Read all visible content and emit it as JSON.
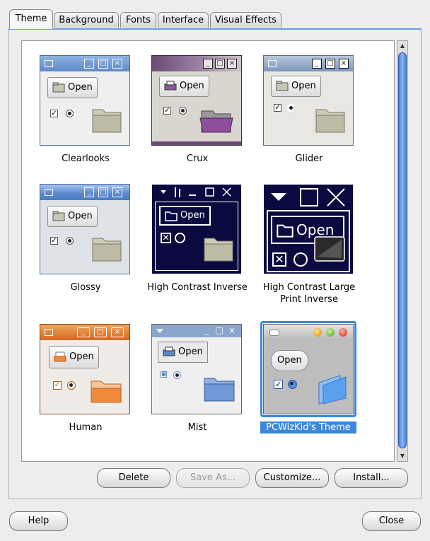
{
  "tabs": [
    {
      "label": "Theme",
      "active": true
    },
    {
      "label": "Background"
    },
    {
      "label": "Fonts"
    },
    {
      "label": "Interface"
    },
    {
      "label": "Visual Effects"
    }
  ],
  "themes": [
    {
      "name": "Clearlooks",
      "open": "Open"
    },
    {
      "name": "Crux",
      "open": "Open"
    },
    {
      "name": "Glider",
      "open": "Open"
    },
    {
      "name": "Glossy",
      "open": "Open"
    },
    {
      "name": "High Contrast Inverse",
      "open": "Open"
    },
    {
      "name": "High Contrast Large Print Inverse",
      "open": "Open"
    },
    {
      "name": "Human",
      "open": "Open"
    },
    {
      "name": "Mist",
      "open": "Open"
    },
    {
      "name": "PCWizKid's Theme",
      "open": "Open",
      "selected": true
    }
  ],
  "actions": {
    "delete": "Delete",
    "save_as": "Save As...",
    "customize": "Customize...",
    "install": "Install..."
  },
  "footer": {
    "help": "Help",
    "close": "Close"
  },
  "colors": {
    "accent": "#3d87d8",
    "tab_underline": "#6a9be0",
    "scroll_thumb": "#3f7ee0"
  }
}
